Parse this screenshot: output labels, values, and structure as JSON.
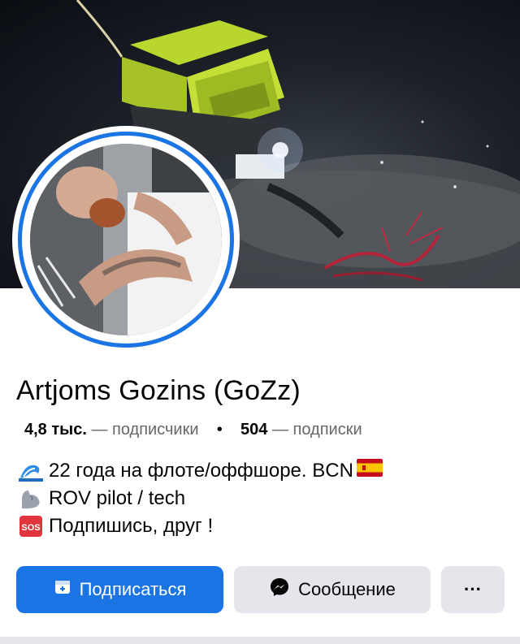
{
  "profile": {
    "name": "Artjoms Gozins (GoZz)",
    "followers_count": "4,8 тыс.",
    "followers_label": "подписчики",
    "following_count": "504",
    "following_label": "подписки",
    "separator_dash": "—",
    "dot": "•"
  },
  "bio": {
    "line1": "22 года на флоте/оффшоре. BCN",
    "line2": "ROV pilot / tech",
    "line3": "Подпишись, друг !",
    "sos_badge": "SOS",
    "icons": [
      "wave-icon",
      "spain-flag-icon",
      "flexed-biceps-icon",
      "sos-icon"
    ]
  },
  "actions": {
    "follow_label": "Подписаться",
    "message_label": "Сообщение",
    "more_label": "···"
  },
  "colors": {
    "primary": "#1b74e4",
    "secondary_bg": "#e4e6eb",
    "muted_text": "#65676b"
  }
}
